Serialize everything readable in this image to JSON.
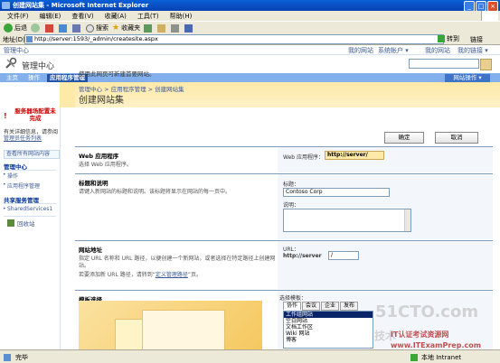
{
  "window": {
    "title": "创建网站集 - Microsoft Internet Explorer"
  },
  "menu": [
    "文件(F)",
    "编辑(E)",
    "查看(V)",
    "收藏(A)",
    "工具(T)",
    "帮助(H)"
  ],
  "toolbar": {
    "back": "后退",
    "search": "搜索",
    "favorites": "收藏夹"
  },
  "address": {
    "label": "地址(D)",
    "url": "http://server:1593/_admin/createsite.aspx",
    "go": "转到",
    "links": "链接"
  },
  "sp": {
    "site_name": "管理中心",
    "top_links": [
      "我的网站",
      "系统帐户 ▾",
      "我的网站",
      "我的链接 ▾"
    ],
    "title": "管理中心",
    "tabs": {
      "home": "主页",
      "operations": "操作",
      "app_mgmt": "应用程序管理"
    },
    "site_actions": "网站操作 ▾",
    "alert": "服务器场配置未完成",
    "alert_text": "有关详细信息，请参阅",
    "alert_link": "管理员任务列表",
    "view_all": "查看所有网站内容",
    "nav_h1": "管理中心",
    "nav_ops": "操作",
    "nav_app": "应用程序管理",
    "nav_h2": "共享服务管理",
    "nav_ssp": "SharedServices1",
    "recycle": "回收站",
    "breadcrumb": "管理中心 > 应用程序管理 > 创建网站集",
    "page_title": "创建网站集",
    "description": "使用此网页可新建首要网站。",
    "ok": "确定",
    "cancel": "取消",
    "webapp": {
      "heading": "Web 应用程序",
      "desc": "选择 Web 应用程序。",
      "field_label": "Web 应用程序：",
      "value": "http://server/"
    },
    "titledesc": {
      "heading": "标题和说明",
      "desc": "请键入新网站的标题和说明。该标题将显示在网站的每一页中。",
      "title_label": "标题：",
      "title_value": "Contoso Corp",
      "desc_label": "说明："
    },
    "url": {
      "heading": "网站地址",
      "desc": "指定 URL 名称和 URL 路径，以便创建一个新网站，或者选择在特定路径上创建网站。",
      "desc2_pre": "若要添加新 URL 路径，请转到“",
      "desc2_link": "定义管理路径",
      "desc2_post": "”页。",
      "label": "URL：",
      "prefix": "http://server",
      "path": "/"
    },
    "template": {
      "heading": "模板选择",
      "label": "选择模板：",
      "tabs": [
        "协作",
        "会议",
        "企业",
        "发布"
      ],
      "items": [
        "工作组网站",
        "空白网站",
        "文档工作区",
        "Wiki 网站",
        "博客"
      ]
    }
  },
  "watermark": {
    "main": "51CTO.com",
    "line1": "IT认证考试资源网",
    "line2": "www.ITExamPrep.com",
    "tech": "技术"
  },
  "status": {
    "done": "完毕",
    "zone": "本地 Intranet"
  }
}
